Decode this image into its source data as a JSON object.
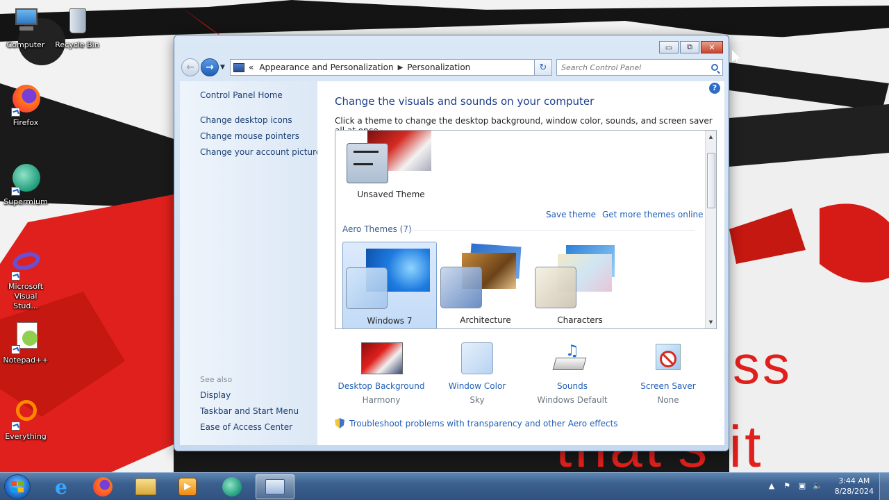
{
  "desktop": {
    "icons": [
      {
        "label": "Computer",
        "icon": "computer-icon"
      },
      {
        "label": "Recycle Bin",
        "icon": "recycle-bin-icon"
      },
      {
        "label": "Firefox",
        "icon": "firefox-icon"
      },
      {
        "label": "Supermium",
        "icon": "supermium-icon"
      },
      {
        "label": "Microsoft Visual Stud...",
        "icon": "visual-studio-icon"
      },
      {
        "label": "Notepad++",
        "icon": "notepad-plus-plus-icon"
      },
      {
        "label": "Everything",
        "icon": "everything-icon"
      }
    ],
    "wallpaper_text_1": "ss",
    "wallpaper_text_2": "that's it"
  },
  "window": {
    "caption": {
      "minimize": "▭",
      "maximize": "⧉",
      "close": "✕"
    },
    "address": {
      "chevrons": "«",
      "crumbs": [
        "Appearance and Personalization",
        "Personalization"
      ]
    },
    "search": {
      "placeholder": "Search Control Panel"
    },
    "sidebar": {
      "home": "Control Panel Home",
      "links": [
        "Change desktop icons",
        "Change mouse pointers",
        "Change your account picture"
      ],
      "see_also_heading": "See also",
      "see_also": [
        "Display",
        "Taskbar and Start Menu",
        "Ease of Access Center"
      ]
    },
    "content": {
      "help": "?",
      "title": "Change the visuals and sounds on your computer",
      "subtitle": "Click a theme to change the desktop background, window color, sounds, and screen saver all at once.",
      "unsaved_theme": "Unsaved Theme",
      "save_theme": "Save theme",
      "get_more": "Get more themes online",
      "aero_heading": "Aero Themes (7)",
      "themes": [
        {
          "name": "Windows 7",
          "selected": true
        },
        {
          "name": "Architecture",
          "selected": false
        },
        {
          "name": "Characters",
          "selected": false
        }
      ],
      "bottom": [
        {
          "label": "Desktop Background",
          "value": "Harmony",
          "icon": "desktop-background-icon"
        },
        {
          "label": "Window Color",
          "value": "Sky",
          "icon": "window-color-icon"
        },
        {
          "label": "Sounds",
          "value": "Windows Default",
          "icon": "sounds-icon"
        },
        {
          "label": "Screen Saver",
          "value": "None",
          "icon": "screen-saver-icon"
        }
      ],
      "troubleshoot": "Troubleshoot problems with transparency and other Aero effects"
    }
  },
  "taskbar": {
    "apps": [
      "Internet Explorer",
      "Firefox",
      "Windows Explorer",
      "Windows Media Player",
      "Supermium",
      "Control Panel"
    ],
    "clock_time": "3:44 AM",
    "clock_date": "8/28/2024"
  },
  "colors": {
    "link": "#1f5fb8",
    "title": "#1e3f8a",
    "wallpaper_red": "#e0201c"
  }
}
